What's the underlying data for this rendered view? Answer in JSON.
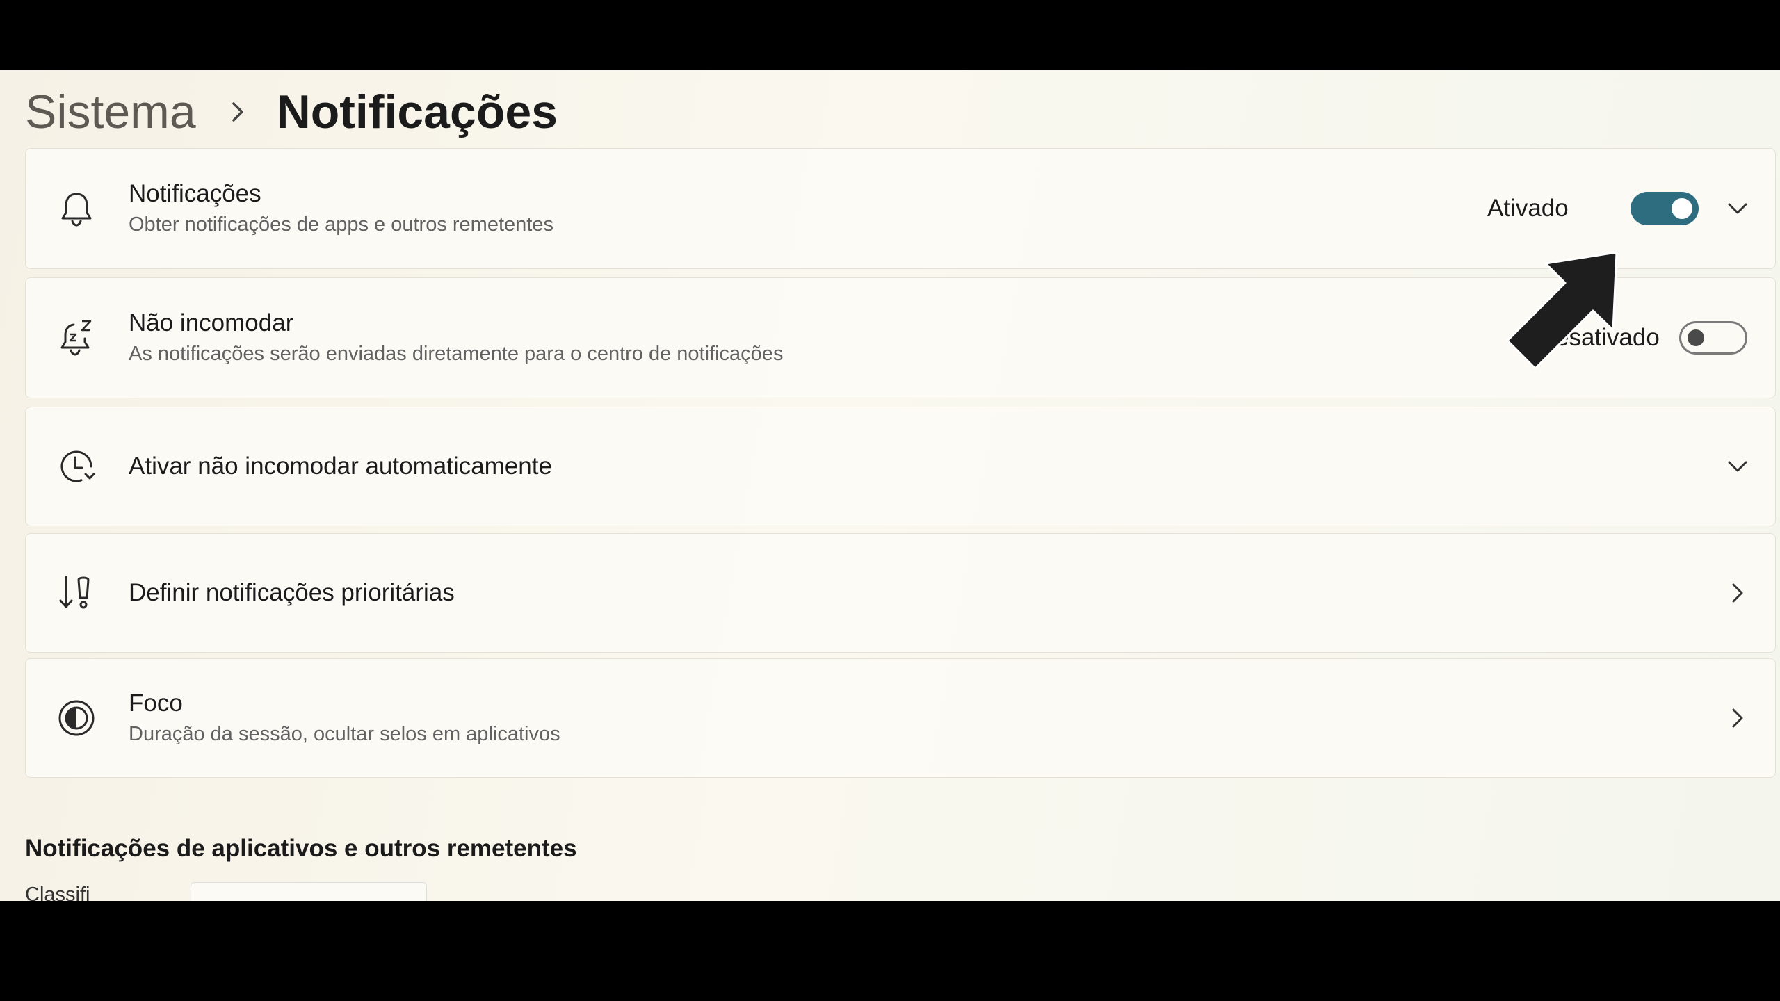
{
  "breadcrumb": {
    "parent": "Sistema",
    "current": "Notificações"
  },
  "cards": [
    {
      "title": "Notificações",
      "subtitle": "Obter notificações de apps e outros remetentes",
      "state": "Ativado",
      "icon": "bell-icon"
    },
    {
      "title": "Não incomodar",
      "subtitle": "As notificações serão enviadas diretamente para o centro de notificações",
      "state": "esativado",
      "icon": "bell-snooze-icon"
    },
    {
      "title": "Ativar não incomodar automaticamente",
      "icon": "clock-icon"
    },
    {
      "title": "Definir notificações prioritárias",
      "icon": "priority-icon"
    },
    {
      "title": "Foco",
      "subtitle": "Duração da sessão, ocultar selos em aplicativos",
      "icon": "focus-icon"
    }
  ],
  "section": {
    "title": "Notificações de aplicativos e outros remetentes"
  },
  "partial": {
    "label": "Classifi"
  },
  "colors": {
    "accent": "#2e6d80"
  }
}
